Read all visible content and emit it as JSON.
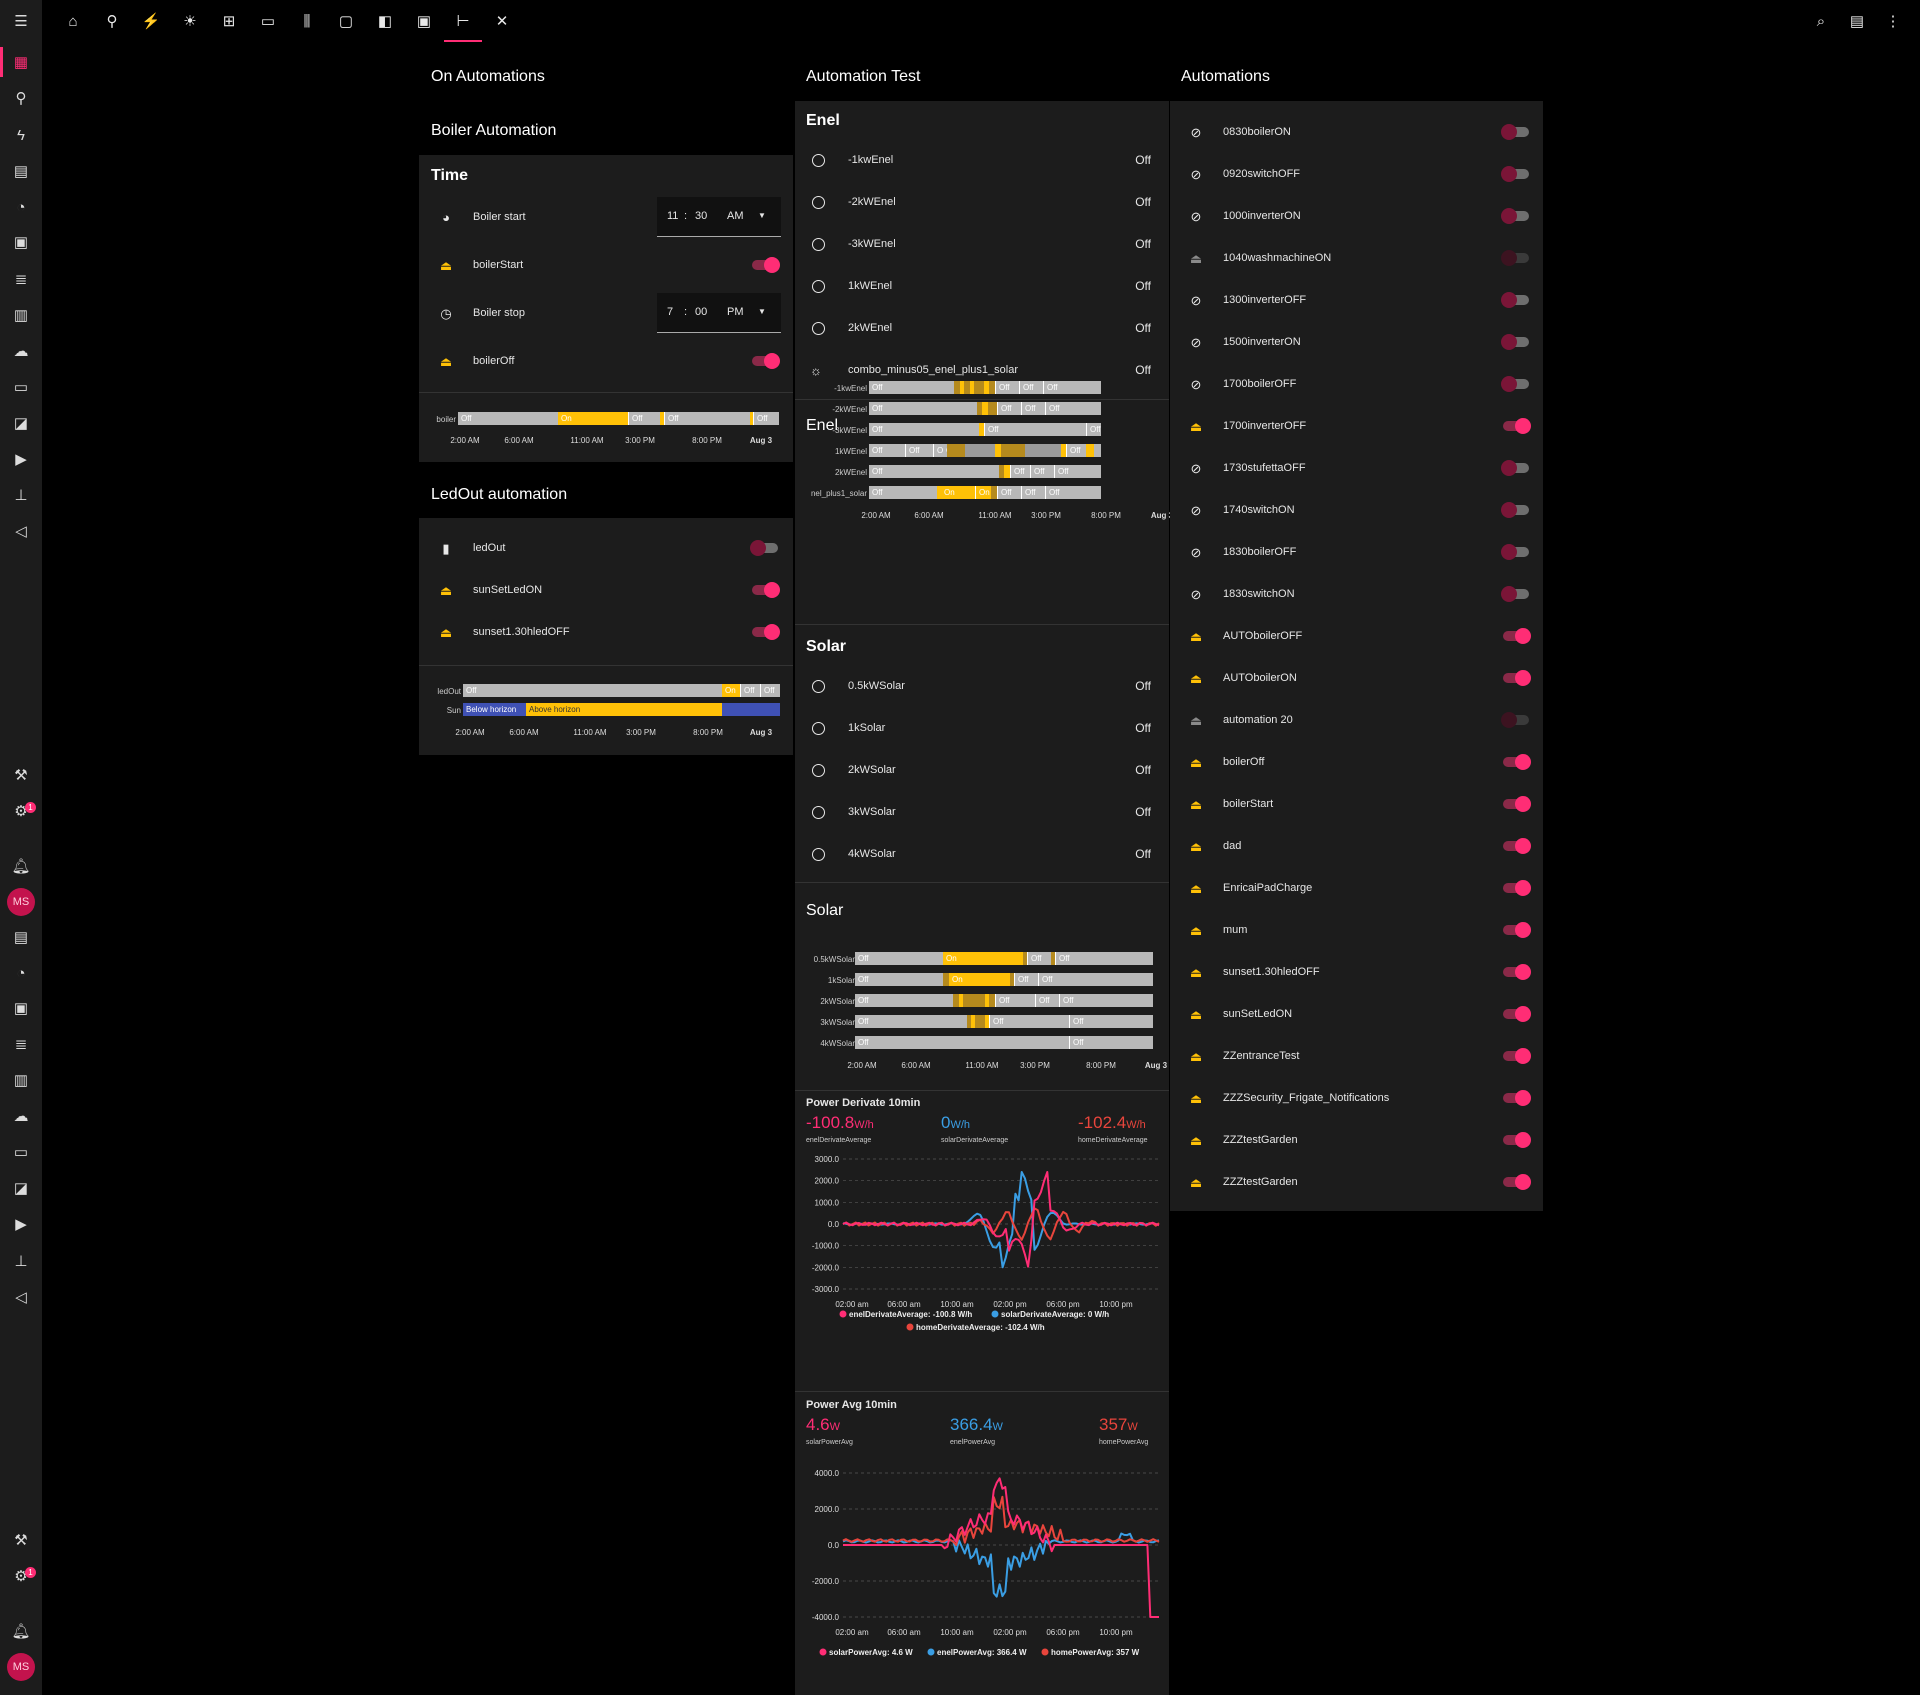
{
  "colors": {
    "accent": "#ff2d75",
    "on": "#ffc107",
    "off": "#b8b8b8",
    "below": "#3f51b5",
    "blue": "#3a9ee4",
    "red": "#e8453c",
    "pink": "#ff2d75"
  },
  "rail": {
    "avatar_initials": "MS",
    "badge_count": "1"
  },
  "topbar": {
    "icons": [
      "home-icon",
      "satellite-icon",
      "plug-icon",
      "weather-icon",
      "network-icon",
      "laptop-icon",
      "radiator-icon",
      "tv-icon",
      "switch-icon",
      "panel-icon",
      "sitemap-icon",
      "tools-icon"
    ],
    "right_icons": [
      "search-icon",
      "chat-icon",
      "more-icon"
    ]
  },
  "columns": {
    "left": "On Automations",
    "mid": "Automation Test",
    "right": "Automations"
  },
  "boiler": {
    "section_title": "Boiler Automation",
    "card_title": "Time",
    "start_label": "Boiler start",
    "start_h": "11",
    "start_m": "30",
    "start_ampm": "AM",
    "boilerStart": "boilerStart",
    "stop_label": "Boiler stop",
    "stop_h": "7",
    "stop_m": "00",
    "stop_ampm": "PM",
    "boilerOff": "boilerOff",
    "tl_label": "boiler",
    "ticks": [
      "2:00 AM",
      "6:00 AM",
      "11:00 AM",
      "3:00 PM",
      "8:00 PM",
      "Aug 3"
    ]
  },
  "ledout": {
    "section_title": "LedOut automation",
    "items": [
      "ledOut",
      "sunSetLedON",
      "sunset1.30hledOFF"
    ],
    "tl_ledout": "ledOut",
    "tl_sun": "Sun",
    "below": "Below horizon",
    "above": "Above horizon",
    "ticks": [
      "2:00 AM",
      "6:00 AM",
      "11:00 AM",
      "3:00 PM",
      "8:00 PM",
      "Aug 3"
    ]
  },
  "enel": {
    "title": "Enel",
    "items": [
      {
        "name": "-1kwEnel",
        "state": "Off"
      },
      {
        "name": "-2kWEnel",
        "state": "Off"
      },
      {
        "name": "-3kWEnel",
        "state": "Off"
      },
      {
        "name": "1kWEnel",
        "state": "Off"
      },
      {
        "name": "2kWEnel",
        "state": "Off"
      },
      {
        "name": "combo_minus05_enel_plus1_solar",
        "state": "Off"
      }
    ],
    "history_title": "Enel",
    "tl_rows": [
      "-1kwEnel",
      "-2kWEnel",
      "-3kWEnel",
      "1kWEnel",
      "2kWEnel",
      "nel_plus1_solar"
    ],
    "ticks": [
      "2:00 AM",
      "6:00 AM",
      "11:00 AM",
      "3:00 PM",
      "8:00 PM",
      "Aug 3"
    ],
    "off": "Off",
    "on": "On"
  },
  "solar": {
    "title": "Solar",
    "items": [
      {
        "name": "0.5kWSolar",
        "state": "Off"
      },
      {
        "name": "1kSolar",
        "state": "Off"
      },
      {
        "name": "2kWSolar",
        "state": "Off"
      },
      {
        "name": "3kWSolar",
        "state": "Off"
      },
      {
        "name": "4kWSolar",
        "state": "Off"
      }
    ],
    "history_title": "Solar",
    "tl_rows": [
      "0.5kWSolar",
      "1kSolar",
      "2kWSolar",
      "3kWSolar",
      "4kWSolar"
    ],
    "ticks": [
      "2:00 AM",
      "6:00 AM",
      "11:00 AM",
      "3:00 PM",
      "8:00 PM",
      "Aug 3"
    ]
  },
  "deriv": {
    "title": "Power Derivate 10min",
    "stats": [
      {
        "v": "-100.8",
        "u": "W/h",
        "l": "enelDerivateAverage"
      },
      {
        "v": "0",
        "u": "W/h",
        "l": "solarDerivateAverage"
      },
      {
        "v": "-102.4",
        "u": "W/h",
        "l": "homeDerivateAverage"
      }
    ],
    "y_ticks": [
      "3000.0",
      "2000.0",
      "1000.0",
      "0.0",
      "-1000.0",
      "-2000.0",
      "-3000.0"
    ],
    "x_ticks": [
      "02:00 am",
      "06:00 am",
      "10:00 am",
      "02:00 pm",
      "06:00 pm",
      "10:00 pm"
    ],
    "legend": [
      "enelDerivateAverage: -100.8 W/h",
      "solarDerivateAverage: 0 W/h",
      "homeDerivateAverage: -102.4 W/h"
    ]
  },
  "avg": {
    "title": "Power Avg 10min",
    "stats": [
      {
        "v": "4.6",
        "u": "W",
        "l": "solarPowerAvg"
      },
      {
        "v": "366.4",
        "u": "W",
        "l": "enelPowerAvg"
      },
      {
        "v": "357",
        "u": "W",
        "l": "homePowerAvg"
      }
    ],
    "y_ticks": [
      "4000.0",
      "2000.0",
      "0.0",
      "-2000.0",
      "-4000.0"
    ],
    "x_ticks": [
      "02:00 am",
      "06:00 am",
      "10:00 am",
      "02:00 pm",
      "06:00 pm",
      "10:00 pm"
    ],
    "legend": [
      "solarPowerAvg: 4.6 W",
      "enelPowerAvg: 366.4 W",
      "homePowerAvg: 357 W"
    ]
  },
  "automations": [
    {
      "name": "0830boilerON",
      "icon": "robot-off",
      "state": "off"
    },
    {
      "name": "0920switchOFF",
      "icon": "robot-off",
      "state": "off"
    },
    {
      "name": "1000inverterON",
      "icon": "robot-off",
      "state": "off"
    },
    {
      "name": "1040washmachineON",
      "icon": "robot-grey",
      "state": "dis"
    },
    {
      "name": "1300inverterOFF",
      "icon": "robot-off",
      "state": "off"
    },
    {
      "name": "1500inverterON",
      "icon": "robot-off",
      "state": "off"
    },
    {
      "name": "1700boilerOFF",
      "icon": "robot-off",
      "state": "off"
    },
    {
      "name": "1700inverterOFF",
      "icon": "robot-on",
      "state": "on"
    },
    {
      "name": "1730stufettaOFF",
      "icon": "robot-off",
      "state": "off"
    },
    {
      "name": "1740switchON",
      "icon": "robot-off",
      "state": "off"
    },
    {
      "name": "1830boilerOFF",
      "icon": "robot-off",
      "state": "off"
    },
    {
      "name": "1830switchON",
      "icon": "robot-off",
      "state": "off"
    },
    {
      "name": "AUTOboilerOFF",
      "icon": "robot-on",
      "state": "on"
    },
    {
      "name": "AUTOboilerON",
      "icon": "robot-on",
      "state": "on"
    },
    {
      "name": "automation 20",
      "icon": "robot-grey",
      "state": "dis"
    },
    {
      "name": "boilerOff",
      "icon": "robot-on",
      "state": "on"
    },
    {
      "name": "boilerStart",
      "icon": "robot-on",
      "state": "on"
    },
    {
      "name": "dad",
      "icon": "robot-on",
      "state": "on"
    },
    {
      "name": "EnricaiPadCharge",
      "icon": "robot-on",
      "state": "on"
    },
    {
      "name": "mum",
      "icon": "robot-on",
      "state": "on"
    },
    {
      "name": "sunset1.30hledOFF",
      "icon": "robot-on",
      "state": "on"
    },
    {
      "name": "sunSetLedON",
      "icon": "robot-on",
      "state": "on"
    },
    {
      "name": "ZZentranceTest",
      "icon": "robot-on",
      "state": "on"
    },
    {
      "name": "ZZZSecurity_Frigate_Notifications",
      "icon": "robot-on",
      "state": "on"
    },
    {
      "name": "ZZZtestGarden",
      "icon": "robot-on",
      "state": "on"
    },
    {
      "name": "ZZZtestGarden",
      "icon": "robot-on",
      "state": "on"
    }
  ]
}
